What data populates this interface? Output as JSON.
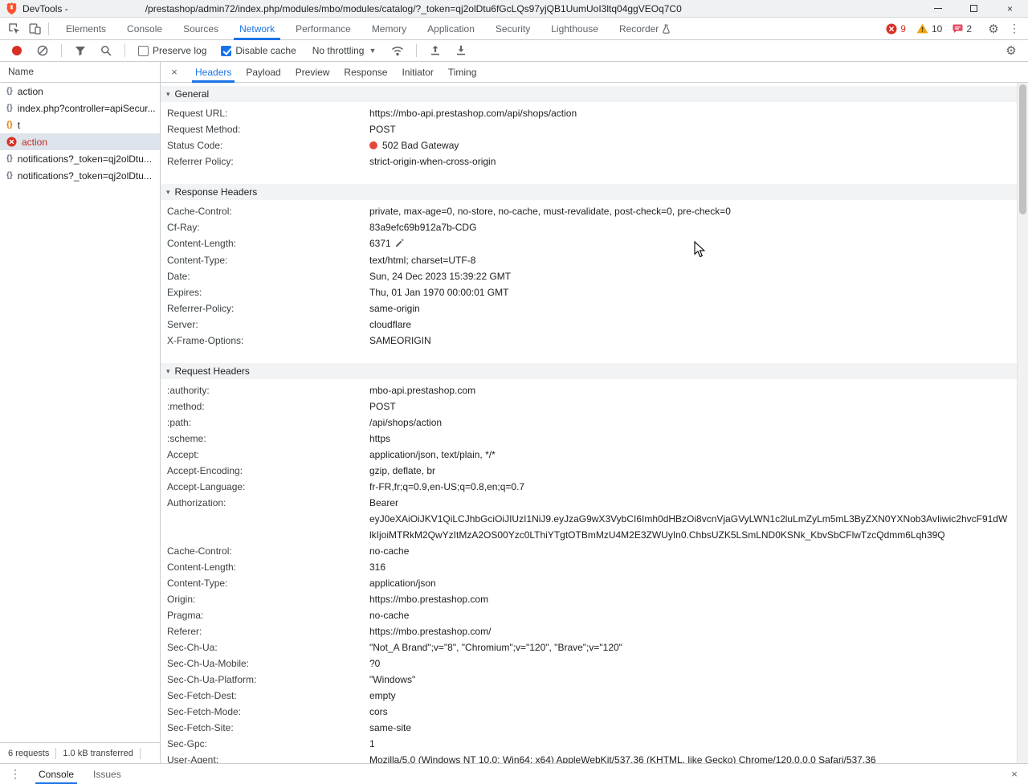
{
  "titlebar": {
    "title": "DevTools -",
    "url": "/prestashop/admin72/index.php/modules/mbo/modules/catalog/?_token=qj2olDtu6fGcLQs97yjQB1UumUoI3ltq04ggVEOq7C0"
  },
  "panel_tabs": {
    "items": [
      {
        "label": "Elements"
      },
      {
        "label": "Console"
      },
      {
        "label": "Sources"
      },
      {
        "label": "Network"
      },
      {
        "label": "Performance"
      },
      {
        "label": "Memory"
      },
      {
        "label": "Application"
      },
      {
        "label": "Security"
      },
      {
        "label": "Lighthouse"
      },
      {
        "label": "Recorder"
      }
    ],
    "active": "Network",
    "error_count": "9",
    "warning_count": "10",
    "issue_count": "2"
  },
  "toolbar": {
    "preserve_log_label": "Preserve log",
    "disable_cache_label": "Disable cache",
    "throttling_value": "No throttling"
  },
  "request_list": {
    "header": "Name",
    "items": [
      {
        "label": "action",
        "icon": "braces",
        "error": false,
        "selected": false
      },
      {
        "label": "index.php?controller=apiSecur...",
        "icon": "braces",
        "error": false,
        "selected": false
      },
      {
        "label": "t",
        "icon": "braces-orange",
        "error": false,
        "selected": false
      },
      {
        "label": "action",
        "icon": "error",
        "error": true,
        "selected": true
      },
      {
        "label": "notifications?_token=qj2olDtu...",
        "icon": "braces",
        "error": false,
        "selected": false
      },
      {
        "label": "notifications?_token=qj2olDtu...",
        "icon": "braces",
        "error": false,
        "selected": false
      }
    ]
  },
  "detail_tabs": {
    "items": [
      "Headers",
      "Payload",
      "Preview",
      "Response",
      "Initiator",
      "Timing"
    ],
    "active": "Headers"
  },
  "sections": [
    {
      "title": "General",
      "rows": [
        {
          "name": "Request URL:",
          "value": "https://mbo-api.prestashop.com/api/shops/action"
        },
        {
          "name": "Request Method:",
          "value": "POST"
        },
        {
          "name": "Status Code:",
          "value": "502 Bad Gateway",
          "status_dot": true
        },
        {
          "name": "Referrer Policy:",
          "value": "strict-origin-when-cross-origin"
        }
      ]
    },
    {
      "title": "Response Headers",
      "rows": [
        {
          "name": "Cache-Control:",
          "value": "private, max-age=0, no-store, no-cache, must-revalidate, post-check=0, pre-check=0"
        },
        {
          "name": "Cf-Ray:",
          "value": "83a9efc69b912a7b-CDG"
        },
        {
          "name": "Content-Length:",
          "value": "6371",
          "editable": true
        },
        {
          "name": "Content-Type:",
          "value": "text/html; charset=UTF-8"
        },
        {
          "name": "Date:",
          "value": "Sun, 24 Dec 2023 15:39:22 GMT"
        },
        {
          "name": "Expires:",
          "value": "Thu, 01 Jan 1970 00:00:01 GMT"
        },
        {
          "name": "Referrer-Policy:",
          "value": "same-origin"
        },
        {
          "name": "Server:",
          "value": "cloudflare"
        },
        {
          "name": "X-Frame-Options:",
          "value": "SAMEORIGIN"
        }
      ]
    },
    {
      "title": "Request Headers",
      "rows": [
        {
          "name": ":authority:",
          "value": "mbo-api.prestashop.com"
        },
        {
          "name": ":method:",
          "value": "POST"
        },
        {
          "name": ":path:",
          "value": "/api/shops/action"
        },
        {
          "name": ":scheme:",
          "value": "https"
        },
        {
          "name": "Accept:",
          "value": "application/json, text/plain, */*"
        },
        {
          "name": "Accept-Encoding:",
          "value": "gzip, deflate, br"
        },
        {
          "name": "Accept-Language:",
          "value": "fr-FR,fr;q=0.9,en-US;q=0.8,en;q=0.7"
        },
        {
          "name": "Authorization:",
          "value": "Bearer eyJ0eXAiOiJKV1QiLCJhbGciOiJIUzI1NiJ9.eyJzaG9wX3VybCI6Imh0dHBzOi8vcnVjaGVyLWN1c2luLmZyLm5mL3ByZXN0YXNob3AvIiwic2hvcF91dWlkIjoiMTRkM2QwYzItMzA2OS00Yzc0LThiYTgtOTBmMzU4M2E3ZWUyIn0.ChbsUZK5LSmLND0KSNk_KbvSbCFlwTzcQdmm6Lqh39Q"
        },
        {
          "name": "Cache-Control:",
          "value": "no-cache"
        },
        {
          "name": "Content-Length:",
          "value": "316"
        },
        {
          "name": "Content-Type:",
          "value": "application/json"
        },
        {
          "name": "Origin:",
          "value": "https://mbo.prestashop.com"
        },
        {
          "name": "Pragma:",
          "value": "no-cache"
        },
        {
          "name": "Referer:",
          "value": "https://mbo.prestashop.com/"
        },
        {
          "name": "Sec-Ch-Ua:",
          "value": "\"Not_A Brand\";v=\"8\", \"Chromium\";v=\"120\", \"Brave\";v=\"120\""
        },
        {
          "name": "Sec-Ch-Ua-Mobile:",
          "value": "?0"
        },
        {
          "name": "Sec-Ch-Ua-Platform:",
          "value": "\"Windows\""
        },
        {
          "name": "Sec-Fetch-Dest:",
          "value": "empty"
        },
        {
          "name": "Sec-Fetch-Mode:",
          "value": "cors"
        },
        {
          "name": "Sec-Fetch-Site:",
          "value": "same-site"
        },
        {
          "name": "Sec-Gpc:",
          "value": "1"
        },
        {
          "name": "User-Agent:",
          "value": "Mozilla/5.0 (Windows NT 10.0; Win64; x64) AppleWebKit/537.36 (KHTML, like Gecko) Chrome/120.0.0.0 Safari/537.36"
        }
      ]
    }
  ],
  "summary_bar": {
    "requests": "6 requests",
    "transferred": "1.0 kB transferred"
  },
  "drawer": {
    "tabs": [
      "Console",
      "Issues"
    ],
    "active": "Console"
  },
  "colors": {
    "accent_blue": "#1a73e8",
    "error_red": "#d93025",
    "warning_yellow": "#f0a714"
  }
}
